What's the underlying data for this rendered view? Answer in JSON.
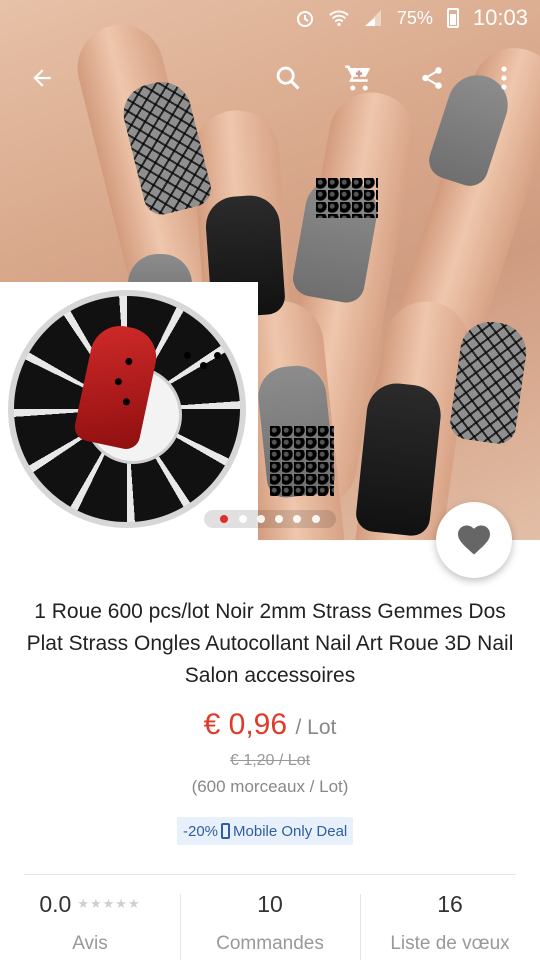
{
  "status_bar": {
    "battery": "75%",
    "time": "10:03",
    "icons": [
      "alarm-icon",
      "wifi-icon",
      "signal-icon",
      "battery-icon"
    ]
  },
  "app_bar": {
    "icons": [
      "back-arrow-icon",
      "search-icon",
      "cart-icon",
      "share-icon",
      "more-vert-icon"
    ]
  },
  "gallery": {
    "page_count": 6,
    "active_page": 1
  },
  "product": {
    "title": "1 Roue 600 pcs/lot Noir 2mm Strass Gemmes Dos Plat Strass Ongles Autocollant Nail Art Roue 3D Nail Salon accessoires",
    "price": "€ 0,96",
    "price_unit": "/ Lot",
    "old_price": "€ 1,20 / Lot",
    "pieces": "(600 morceaux / Lot)",
    "deal_discount": "-20%",
    "deal_label": "Mobile Only Deal"
  },
  "stats": {
    "rating": "0.0",
    "rating_stars": "★★★★★",
    "rating_label": "Avis",
    "orders": "10",
    "orders_label": "Commandes",
    "wishlist": "16",
    "wishlist_label": "Liste de vœux"
  },
  "colors": {
    "price_red": "#e03a2c",
    "deal_blue": "#2f5f9e",
    "deal_bg": "#e8f0fb"
  }
}
